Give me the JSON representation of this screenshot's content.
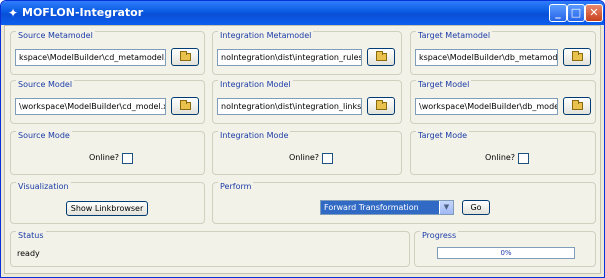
{
  "window": {
    "title": "MOFLON-Integrator",
    "icon": "moflon-app-icon",
    "controls": {
      "minimize": "_",
      "maximize": "□",
      "close": "✕"
    }
  },
  "source_metamodel": {
    "title": "Source Metamodel",
    "path": "kspace\\ModelBuilder\\cd_metamodel.jar"
  },
  "integration_metamodel": {
    "title": "Integration Metamodel",
    "path": "noIntegration\\dist\\integration_rules.jar"
  },
  "target_metamodel": {
    "title": "Target Metamodel",
    "path": "kspace\\ModelBuilder\\db_metamodel.jar"
  },
  "source_model": {
    "title": "Source Model",
    "path": "\\workspace\\ModelBuilder\\cd_model.xml"
  },
  "integration_model": {
    "title": "Integration Model",
    "path": "noIntegration\\dist\\integration_links.xmi"
  },
  "target_model": {
    "title": "Target Model",
    "path": "\\workspace\\ModelBuilder\\db_model.xml"
  },
  "source_mode": {
    "title": "Source Mode",
    "online_label": "Online?",
    "checked": false
  },
  "integration_mode": {
    "title": "Integration Mode",
    "online_label": "Online?",
    "checked": false
  },
  "target_mode": {
    "title": "Target Mode",
    "online_label": "Online?",
    "checked": false
  },
  "visualization": {
    "title": "Visualization",
    "button_label": "Show Linkbrowser"
  },
  "perform": {
    "title": "Perform",
    "selected": "Forward Transformation",
    "go_label": "Go"
  },
  "status": {
    "title": "Status",
    "value": "ready"
  },
  "progress": {
    "title": "Progress",
    "text": "0%",
    "fraction": 0
  }
}
